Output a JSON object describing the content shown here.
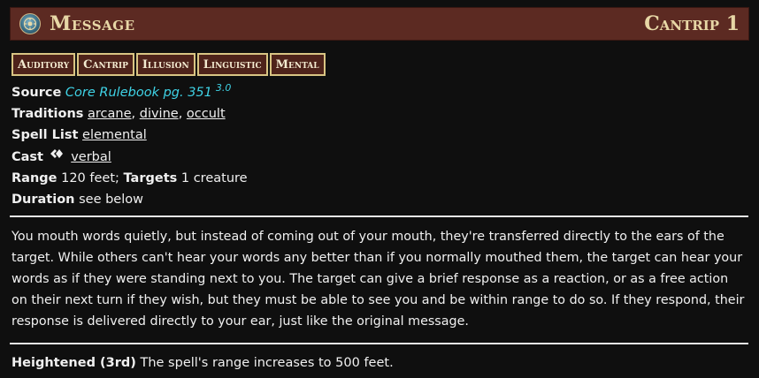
{
  "header": {
    "icon": "school-divination-icon",
    "title": "Message",
    "level": "Cantrip 1"
  },
  "traits": [
    "Auditory",
    "Cantrip",
    "Illusion",
    "Linguistic",
    "Mental"
  ],
  "source": {
    "label": "Source",
    "book": "Core Rulebook pg. 351",
    "version": "3.0"
  },
  "traditions": {
    "label": "Traditions",
    "items": [
      "arcane",
      "divine",
      "occult"
    ],
    "sep": ", "
  },
  "spell_list": {
    "label": "Spell List",
    "value": "elemental"
  },
  "cast": {
    "label": "Cast",
    "action_icon": "single-action-icon",
    "value": "verbal"
  },
  "range": {
    "label": "Range",
    "value": "120 feet;",
    "targets_label": "Targets",
    "targets_value": "1 creature"
  },
  "duration": {
    "label": "Duration",
    "value": "see below"
  },
  "description": "You mouth words quietly, but instead of coming out of your mouth, they're transferred directly to the ears of the target. While others can't hear your words any better than if you normally mouthed them, the target can hear your words as if they were standing next to you. The target can give a brief response as a reaction, or as a free action on their next turn if they wish, but they must be able to see you and be within range to do so. If they respond, their response is delivered directly to your ear, just like the original message.",
  "heightened": {
    "label": "Heightened (3rd)",
    "text": "The spell's range increases to 500 feet."
  },
  "colors": {
    "header_bg": "#5c2a22",
    "title": "#e7d7a6",
    "trait_border": "#d8c483",
    "link_accent": "#3fd3e6",
    "background": "#0f0f0f"
  }
}
